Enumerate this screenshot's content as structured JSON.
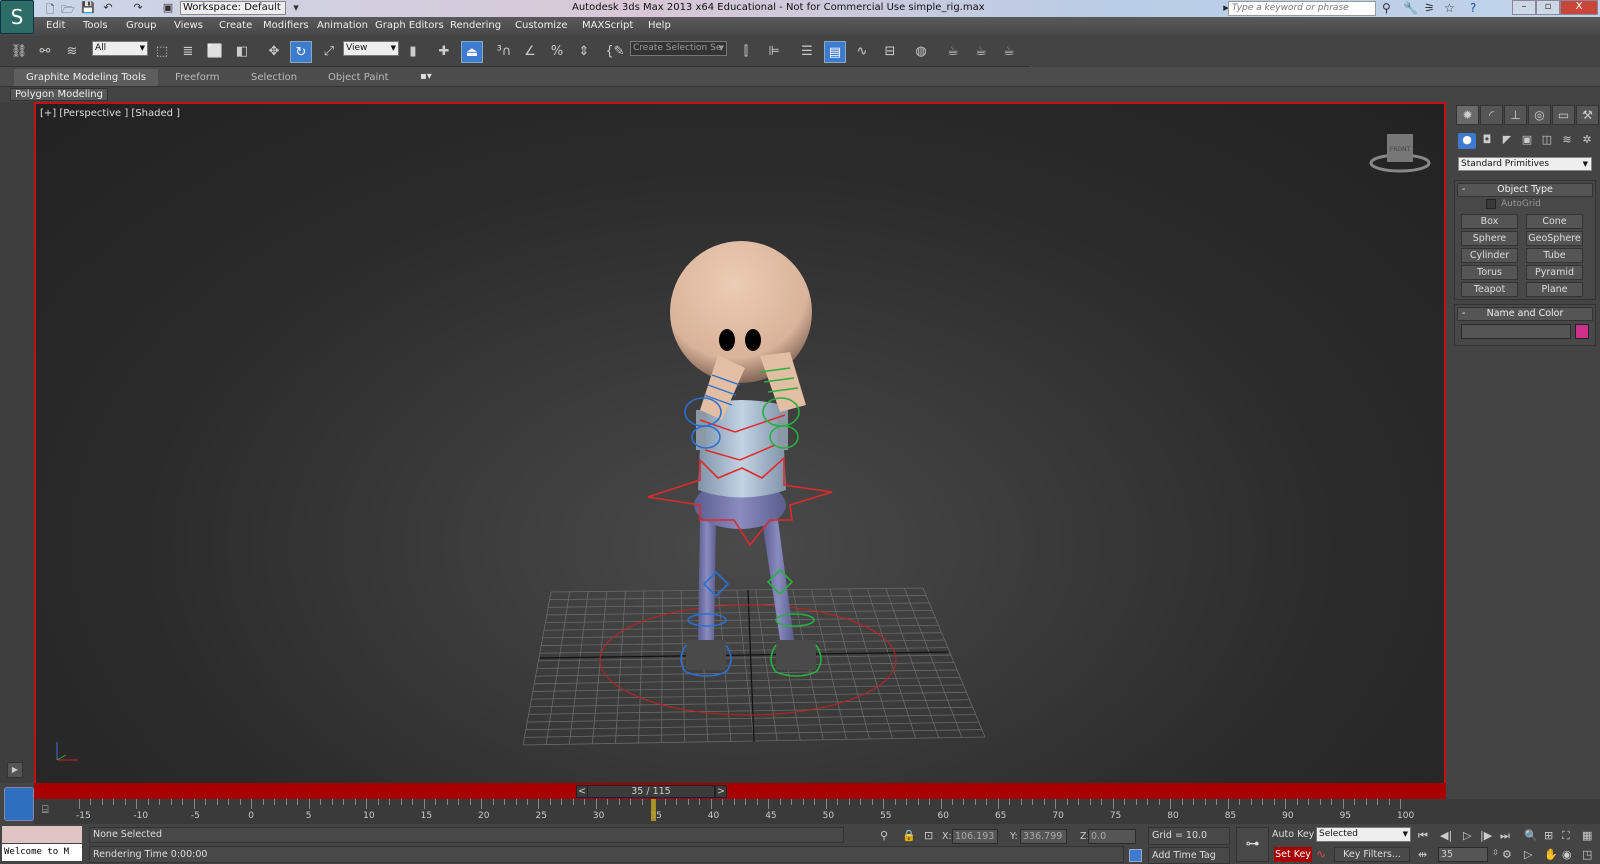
{
  "titlebar": {
    "workspace": "Workspace: Default",
    "title": "Autodesk 3ds Max  2013 x64   Educational - Not for Commercial Use    simple_rig.max",
    "search_placeholder": "Type a keyword or phrase",
    "minimize": "–",
    "restore": "▫",
    "close": "X"
  },
  "menu": [
    "Edit",
    "Tools",
    "Group",
    "Views",
    "Create",
    "Modifiers",
    "Animation",
    "Graph Editors",
    "Rendering",
    "Customize",
    "MAXScript",
    "Help"
  ],
  "toolbar": {
    "selection_filter": "All",
    "ref_coord": "View",
    "named_selection": "Create Selection Se"
  },
  "ribbon": {
    "tabs": [
      "Graphite Modeling Tools",
      "Freeform",
      "Selection",
      "Object Paint"
    ],
    "panel": "Polygon Modeling"
  },
  "viewport": {
    "label": "[+] [Perspective ] [Shaded ]",
    "accent": "#c41010",
    "cube_label": "FRONT"
  },
  "command_panel": {
    "category": "Standard Primitives",
    "object_type_title": "Object Type",
    "autogrid": "AutoGrid",
    "primitives": [
      "Box",
      "Cone",
      "Sphere",
      "GeoSphere",
      "Cylinder",
      "Tube",
      "Torus",
      "Pyramid",
      "Teapot",
      "Plane"
    ],
    "name_color_title": "Name and Color",
    "name_value": "",
    "object_color": "#cc2f8c"
  },
  "timeline": {
    "slider_text": "35 / 115",
    "prev": "<",
    "next": ">",
    "current_frame": 35,
    "start": -15,
    "end": 100,
    "labels": [
      "-15",
      "-10",
      "-5",
      "0",
      "5",
      "10",
      "15",
      "20",
      "25",
      "30",
      "35",
      "40",
      "45",
      "50",
      "55",
      "60",
      "65",
      "70",
      "75",
      "80",
      "85",
      "90",
      "95",
      "100"
    ]
  },
  "status": {
    "listener": "Welcome to M",
    "selection": "None Selected",
    "rendering_time": "Rendering Time  0:00:00",
    "x_label": "X:",
    "x": "106.193",
    "y_label": "Y:",
    "y": "336.799",
    "z_label": "Z:",
    "z": "0.0",
    "grid": "Grid = 10.0",
    "add_time_tag": "Add Time Tag",
    "auto_key": "Auto Key",
    "key_mode": "Selected",
    "set_key": "Set Key",
    "key_filters": "Key Filters...",
    "frame": "35"
  }
}
